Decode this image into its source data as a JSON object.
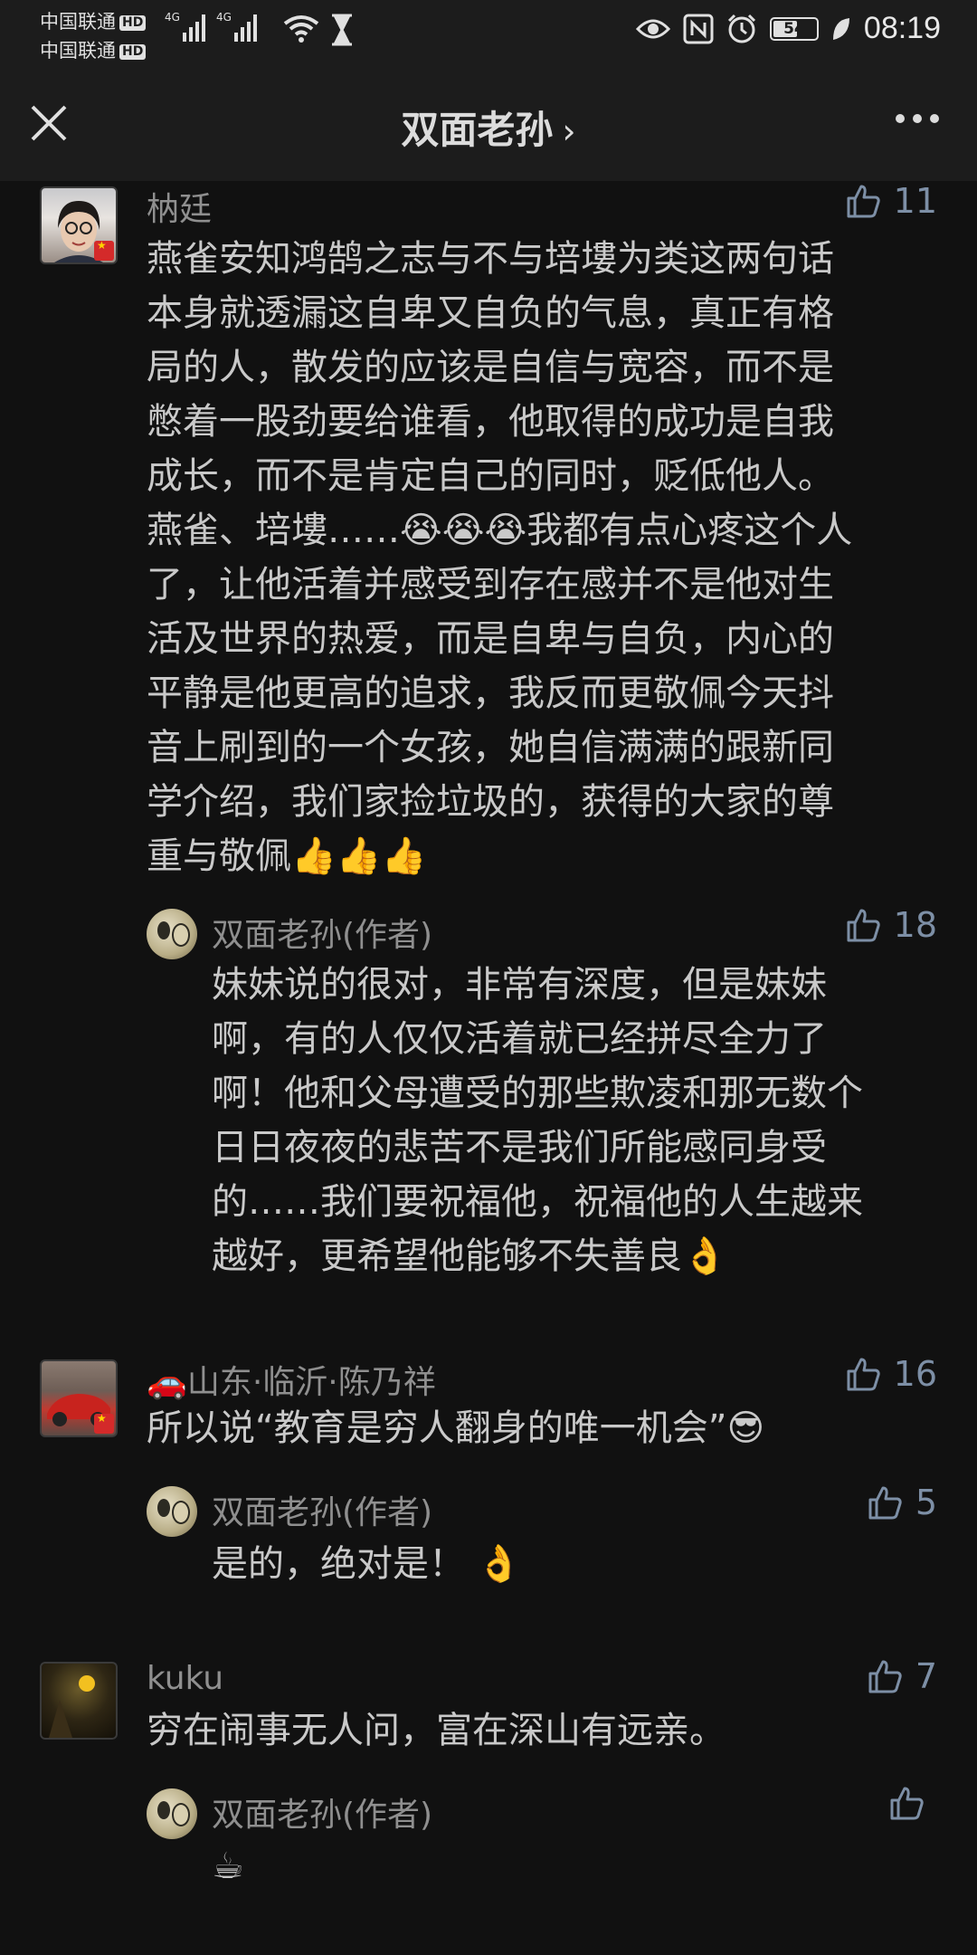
{
  "status_bar": {
    "carrier1": "中国联通",
    "carrier2": "中国联通",
    "hd": "HD",
    "network1": "4G",
    "network2": "4G",
    "battery": "54",
    "time": "08:19",
    "icons": [
      "eye-icon",
      "nfc-icon",
      "alarm-icon",
      "leaf-icon",
      "wifi-icon",
      "hourglass-icon"
    ]
  },
  "nav": {
    "title": "双面老孙",
    "chevron": "›",
    "close_icon": "close-icon",
    "more_icon": "more-icon"
  },
  "comments": [
    {
      "username": "枘廷",
      "likes": "11",
      "lines": [
        "燕雀安知鸿鹄之志与不与培塿为类这两句话",
        "本身就透漏这自卑又自负的气息，真正有格",
        "局的人，散发的应该是自信与宽容，而不是",
        "憋着一股劲要给谁看，他取得的成功是自我",
        "成长，而不是肯定自己的同时，贬低他人。",
        "燕雀、培塿……😭😭😭我都有点心疼这个人",
        "了，让他活着并感受到存在感并不是他对生",
        "活及世界的热爱，而是自卑与自负，内心的",
        "平静是他更高的追求，我反而更敬佩今天抖",
        "音上刷到的一个女孩，她自信满满的跟新同",
        "学介绍，我们家捡垃圾的，获得的大家的尊",
        "重与敬佩👍👍👍"
      ],
      "reply": {
        "username": "双面老孙(作者)",
        "likes": "18",
        "lines": [
          "妹妹说的很对，非常有深度，但是妹妹",
          "啊，有的人仅仅活着就已经拼尽全力了",
          "啊！他和父母遭受的那些欺凌和那无数个",
          "日日夜夜的悲苦不是我们所能感同身受",
          "的……我们要祝福他，祝福他的人生越来",
          "越好，更希望他能够不失善良👌"
        ]
      }
    },
    {
      "username": "🚗山东·临沂·陈乃祥",
      "likes": "16",
      "lines": [
        "所以说“教育是穷人翻身的唯一机会”😎"
      ],
      "reply": {
        "username": "双面老孙(作者)",
        "likes": "5",
        "lines": [
          "是的，绝对是！ 👌"
        ]
      }
    },
    {
      "username": "kuku",
      "likes": "7",
      "lines": [
        "穷在闹事无人问，富在深山有远亲。"
      ],
      "reply": {
        "username": "双面老孙(作者)",
        "likes": "",
        "lines": [
          "☕"
        ]
      }
    }
  ]
}
